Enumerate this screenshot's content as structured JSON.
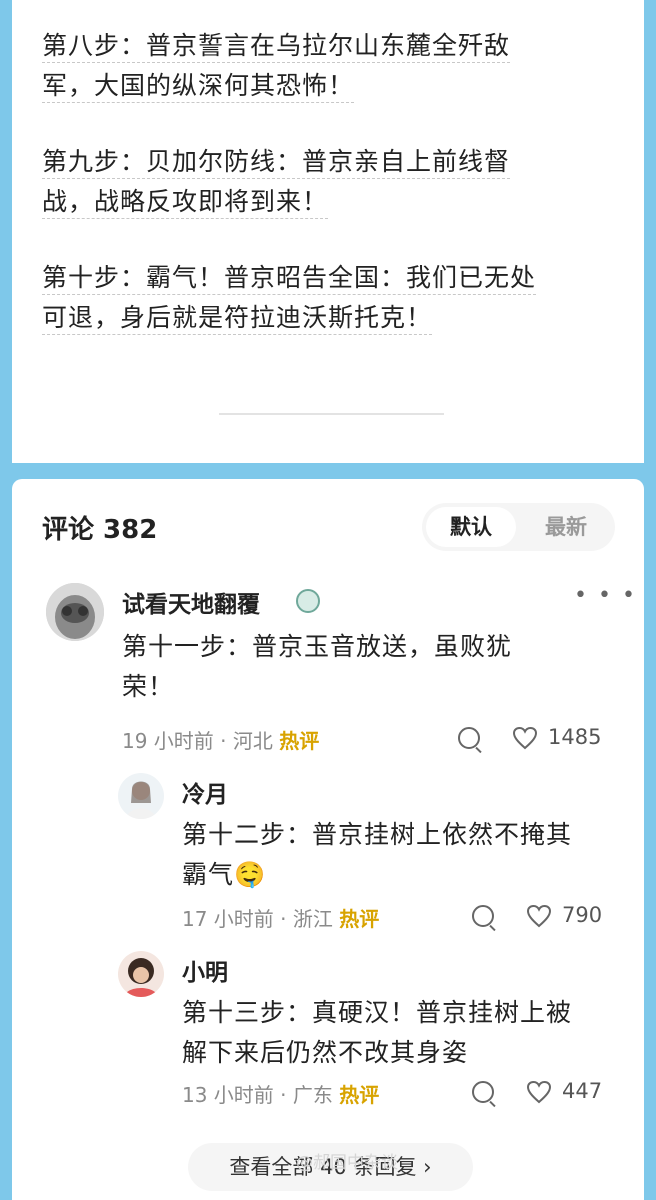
{
  "article": {
    "steps": [
      {
        "line1": "第八步：普京誓言在乌拉尔山东麓全歼敌",
        "line2": "军，大国的纵深何其恐怖！"
      },
      {
        "line1": "第九步：贝加尔防线：普京亲自上前线督",
        "line2": "战，战略反攻即将到来！"
      },
      {
        "line1": "第十步：霸气！普京昭告全国：我们已无处",
        "line2": "可退，身后就是符拉迪沃斯托克！"
      }
    ]
  },
  "comments": {
    "title": "评论 382",
    "sort": {
      "default_label": "默认",
      "latest_label": "最新"
    },
    "main": {
      "user": "试看天地翻覆",
      "text_line1": "第十一步：普京玉音放送，虽败犹",
      "text_line2": "荣！",
      "time": "19 小时前",
      "location": "河北",
      "hot": "热评",
      "likes": "1485"
    },
    "replies": [
      {
        "user": "冷月",
        "text_line1": "第十二步：普京挂树上依然不掩其",
        "text_line2": "霸气",
        "emoji": "🤤",
        "time": "17 小时前",
        "location": "浙江",
        "hot": "热评",
        "likes": "790"
      },
      {
        "user": "小明",
        "text_line1": "第十三步：真硬汉！普京挂树上被",
        "text_line2": "解下来后仍然不改其身姿",
        "time": "13 小时前",
        "location": "广东",
        "hot": "热评",
        "likes": "447"
      }
    ],
    "view_all": "查看全部 40 条回复 ›"
  },
  "watermark": "@郝国中杂谈"
}
